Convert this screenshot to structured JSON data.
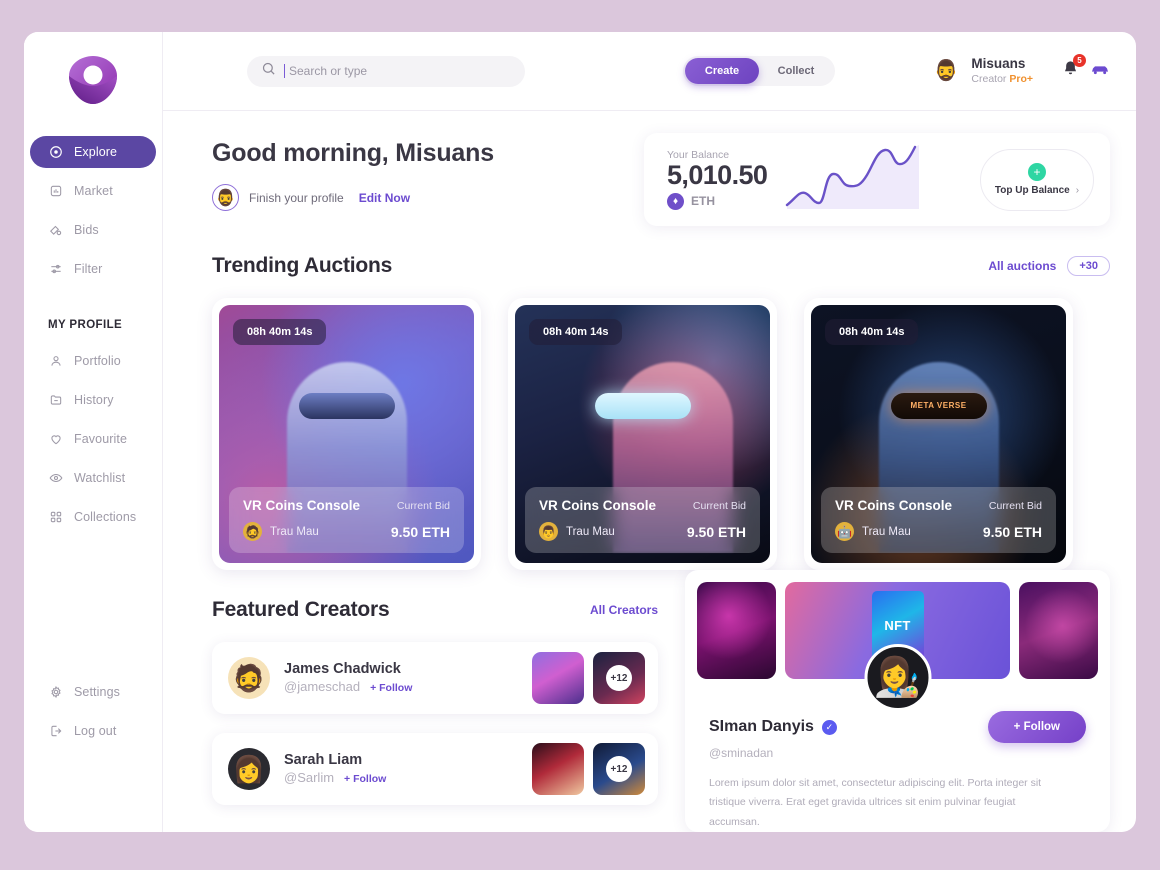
{
  "brand": {
    "logo_name": "nft-logo",
    "accent": "#6c4bd0",
    "active_nav_bg": "#5b47a3"
  },
  "sidebar": {
    "primary": [
      {
        "label": "Explore",
        "icon": "compass-icon",
        "active": true
      },
      {
        "label": "Market",
        "icon": "chart-square-icon",
        "active": false
      },
      {
        "label": "Bids",
        "icon": "gavel-icon",
        "active": false
      },
      {
        "label": "Filter",
        "icon": "filter-icon",
        "active": false
      }
    ],
    "section_label": "MY PROFILE",
    "profile": [
      {
        "label": "Portfolio",
        "icon": "user-icon"
      },
      {
        "label": "History",
        "icon": "folder-icon"
      },
      {
        "label": "Favourite",
        "icon": "heart-icon"
      },
      {
        "label": "Watchlist",
        "icon": "eye-icon"
      },
      {
        "label": "Collections",
        "icon": "grid-icon"
      }
    ],
    "footer": [
      {
        "label": "Settings",
        "icon": "gear-icon"
      },
      {
        "label": "Log out",
        "icon": "logout-icon"
      }
    ]
  },
  "topbar": {
    "search": {
      "placeholder": "Search or type",
      "value": "",
      "icon": "search-icon"
    },
    "segments": [
      {
        "label": "Create",
        "active": true
      },
      {
        "label": "Collect",
        "active": false
      }
    ],
    "user": {
      "avatar": "🧔‍♂️",
      "name": "Misuans",
      "role_prefix": "Creator ",
      "role_badge": "Pro+",
      "role_badge_color": "#f0912f"
    },
    "notifications": {
      "icon": "bell-icon",
      "count": "5",
      "badge_color": "#e8332a"
    },
    "secondary_icon": "vehicle-icon"
  },
  "greeting": {
    "title": "Good morning, Misuans",
    "avatar": "🧔‍♂️",
    "prompt": "Finish your profile",
    "action": "Edit Now"
  },
  "balance": {
    "label": "Your Balance",
    "amount": "5,010.50",
    "currency": "ETH",
    "currency_icon": "♦",
    "topup_label": "Top Up Balance",
    "topup_chevron": "›",
    "plus": "+"
  },
  "chart_data": {
    "type": "area",
    "title": "Balance trend sparkline",
    "x": [
      0,
      1,
      2,
      3,
      4,
      5,
      6,
      7,
      8,
      9,
      10
    ],
    "values": [
      10,
      22,
      14,
      20,
      44,
      40,
      42,
      72,
      82,
      70,
      92
    ],
    "ylim": [
      0,
      100
    ],
    "grid": false,
    "legend": "none",
    "line_color": "#6a52c8",
    "fill_color": "#efeafb"
  },
  "auctions": {
    "title": "Trending Auctions",
    "all_link": "All auctions",
    "count_pill": "+30",
    "cards": [
      {
        "timer": "08h 40m 14s",
        "title": "VR Coins Console",
        "bid_label": "Current Bid",
        "owner": "Trau Mau",
        "owner_avatar": "🧔",
        "price": "9.50 ETH",
        "art": "art1",
        "silhouette": "s1",
        "visor": "v1"
      },
      {
        "timer": "08h 40m 14s",
        "title": "VR Coins Console",
        "bid_label": "Current Bid",
        "owner": "Trau Mau",
        "owner_avatar": "👨",
        "price": "9.50 ETH",
        "art": "art2",
        "silhouette": "s2",
        "visor": "v2"
      },
      {
        "timer": "08h 40m 14s",
        "title": "VR Coins Console",
        "bid_label": "Current Bid",
        "owner": "Trau Mau",
        "owner_avatar": "🤖",
        "price": "9.50 ETH",
        "art": "art3",
        "silhouette": "s3",
        "visor": "v3"
      }
    ]
  },
  "creators": {
    "title": "Featured Creators",
    "all_link": "All Creators",
    "items": [
      {
        "name": "James Chadwick",
        "handle": "@jameschad",
        "follow": "+ Follow",
        "avatar": "🧔",
        "thumb_a": "t-a",
        "thumb_b": "t-b",
        "more": "+12"
      },
      {
        "name": "Sarah Liam",
        "handle": "@Sarlim",
        "follow": "+ Follow",
        "avatar": "👩",
        "thumb_a": "t-c",
        "thumb_b": "t-d",
        "more": "+12"
      }
    ]
  },
  "featured_profile": {
    "name": "SIman Danyis",
    "verified_icon": "✓",
    "handle": "@sminadan",
    "follow_label": "+ Follow",
    "avatar": "👩‍🎨",
    "gallery_center_label": "NFT",
    "bio": "Lorem ipsum dolor sit amet, consectetur adipiscing elit. Porta integer sit tristique viverra. Erat eget gravida ultrices sit enim pulvinar feugiat accumsan."
  }
}
